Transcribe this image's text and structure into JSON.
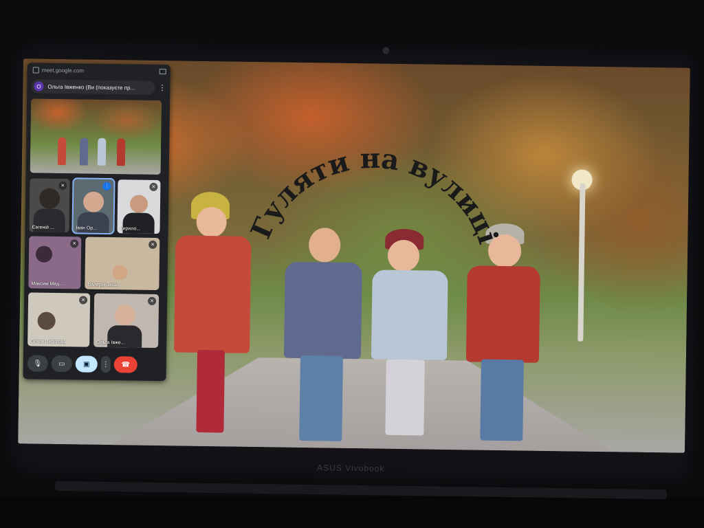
{
  "meet": {
    "url": "meet.google.com",
    "presenter_initial": "О",
    "presenter_title": "Ольга Івженко (Ви (показуєте пр...",
    "more_label": "⋮",
    "tiles": [
      {
        "name": "Євгеній ...",
        "mic": "muted"
      },
      {
        "name": "Іван Ор...",
        "mic": "speaking"
      },
      {
        "name": "Кирило...",
        "mic": "muted"
      },
      {
        "name": "Максим Мед...",
        "mic": "muted"
      },
      {
        "name": "Валерія Зкза...",
        "mic": "muted"
      },
      {
        "name": "Ольга Пирогова",
        "mic": "muted"
      },
      {
        "name": "Ольга Івже...",
        "mic": "muted"
      }
    ],
    "controls": {
      "mic": "🎙",
      "camera": "▭",
      "present": "▣",
      "more": "⋮",
      "end": "☎"
    }
  },
  "slide": {
    "title": "Гуляти на вулиці",
    "title_color": "#1a1a1a"
  },
  "laptop": {
    "brand": "ASUS Vivobook"
  }
}
